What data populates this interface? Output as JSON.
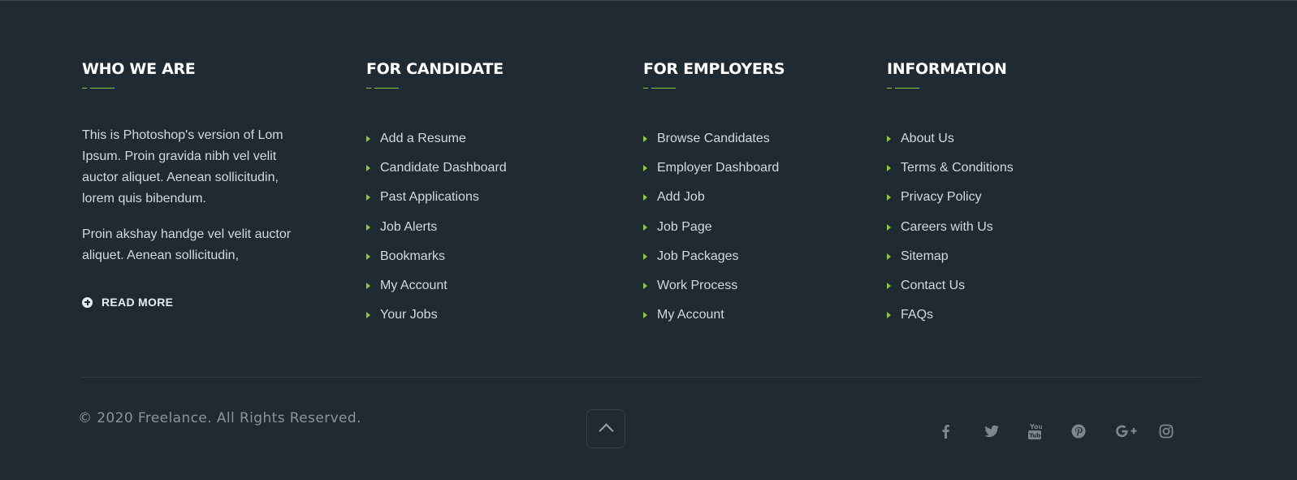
{
  "about": {
    "title": "WHO WE ARE",
    "paragraph1": "This is Photoshop's version of Lom Ipsum. Proin gravida nibh vel velit auctor aliquet. Aenean sollicitudin, lorem quis bibendum.",
    "paragraph2": "Proin akshay handge vel velit auctor aliquet. Aenean sollicitudin,",
    "read_more": "READ MORE"
  },
  "candidate": {
    "title": "FOR CANDIDATE",
    "links": [
      "Add a Resume",
      "Candidate Dashboard",
      "Past Applications",
      "Job Alerts",
      "Bookmarks",
      "My Account",
      "Your Jobs"
    ]
  },
  "employers": {
    "title": "FOR EMPLOYERS",
    "links": [
      "Browse Candidates",
      "Employer Dashboard",
      "Add Job",
      "Job Page",
      "Job Packages",
      "Work Process",
      "My Account"
    ]
  },
  "information": {
    "title": "INFORMATION",
    "links": [
      "About Us",
      "Terms & Conditions",
      "Privacy Policy",
      "Careers with Us",
      "Sitemap",
      "Contact Us",
      "FAQs"
    ]
  },
  "bottom": {
    "copyright": "© 2020 Freelance. All Rights Reserved."
  },
  "social_icons": [
    "facebook-icon",
    "twitter-icon",
    "youtube-icon",
    "pinterest-icon",
    "google-plus-icon",
    "instagram-icon"
  ],
  "colors": {
    "background": "#1f2a32",
    "accent": "#8dc63f",
    "text": "#d3d9de",
    "muted": "#8a949b"
  }
}
